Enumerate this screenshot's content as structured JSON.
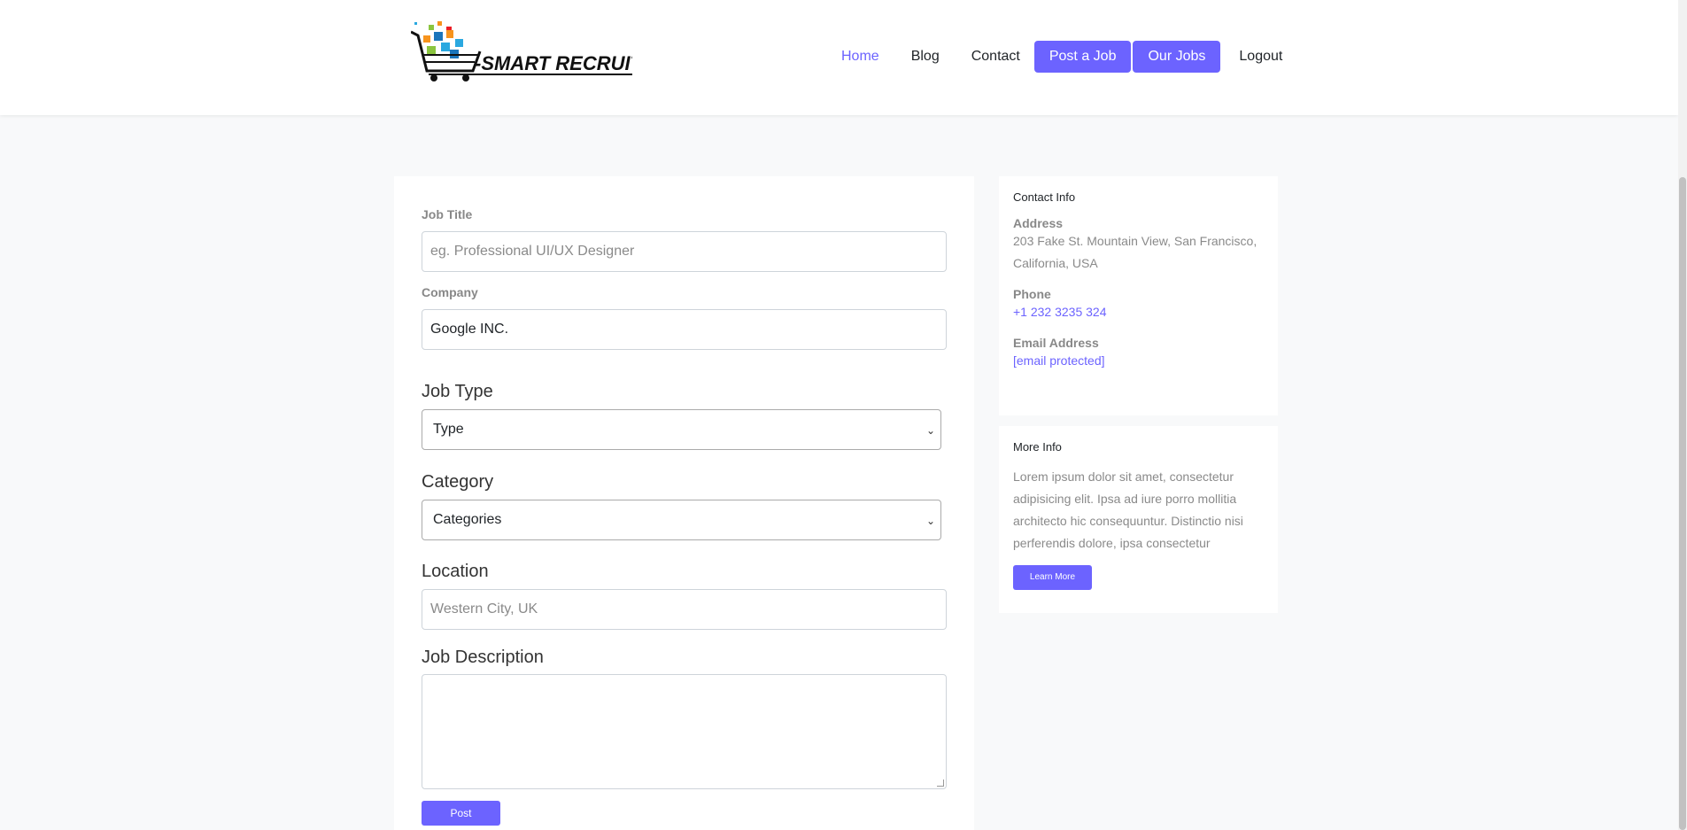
{
  "brand": {
    "logo_text": "-SMART RECRUITER-"
  },
  "nav": {
    "home": "Home",
    "blog": "Blog",
    "contact": "Contact",
    "post_job": "Post a Job",
    "our_jobs": "Our Jobs",
    "logout": "Logout"
  },
  "form": {
    "job_title": {
      "label": "Job Title",
      "placeholder": "eg. Professional UI/UX Designer"
    },
    "company": {
      "label": "Company",
      "value": "Google INC."
    },
    "job_type": {
      "label": "Job Type",
      "selected": "Type"
    },
    "category": {
      "label": "Category",
      "selected": "Categories"
    },
    "location": {
      "label": "Location",
      "placeholder": "Western City, UK"
    },
    "description": {
      "label": "Job Description"
    },
    "submit": "Post"
  },
  "contact_info": {
    "title": "Contact Info",
    "address_label": "Address",
    "address_line1": "203 Fake St. Mountain View, San Francisco,",
    "address_line2": "California, USA",
    "phone_label": "Phone",
    "phone": "+1 232 3235 324",
    "email_label": "Email Address",
    "email": "[email protected]"
  },
  "more_info": {
    "title": "More Info",
    "text_lines": [
      "Lorem ipsum dolor sit amet, consectetur",
      "adipisicing elit. Ipsa ad iure porro mollitia",
      "architecto hic consequuntur. Distinctio nisi",
      "perferendis dolore, ipsa consectetur"
    ],
    "button": "Learn More"
  },
  "colors": {
    "accent": "#6c63ff",
    "page_bg": "#f8f9fa"
  }
}
